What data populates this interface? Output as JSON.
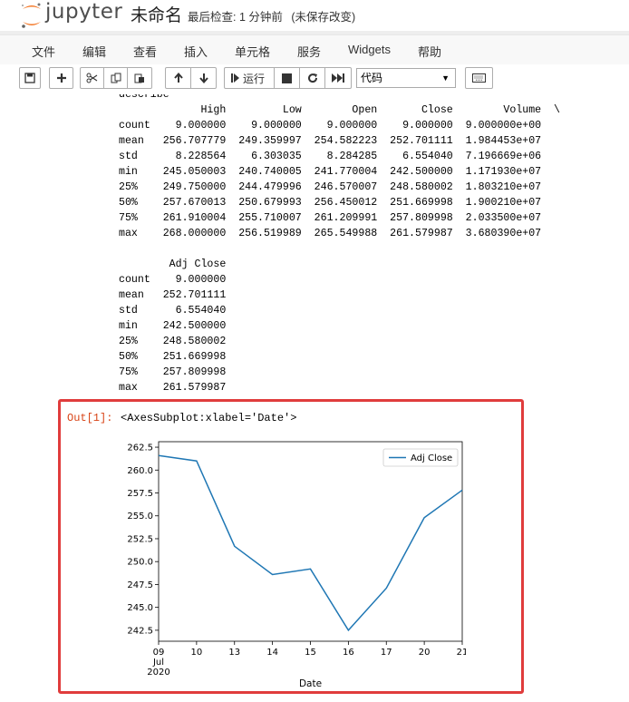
{
  "header": {
    "logo_text": "jupyter",
    "notebook_name": "未命名",
    "checkpoint_label": "最后检查: 1 分钟前",
    "unsaved": "(未保存改变)"
  },
  "menu": [
    "文件",
    "编辑",
    "查看",
    "插入",
    "单元格",
    "服务",
    "Widgets",
    "帮助"
  ],
  "toolbar": {
    "run_label": "运行",
    "cell_type": "代码",
    "icons": [
      "save-icon",
      "plus-icon",
      "cut-icon",
      "copy-icon",
      "paste-icon",
      "arrow-up-icon",
      "arrow-down-icon",
      "step-forward-icon",
      "stop-icon",
      "restart-icon",
      "fast-forward-icon",
      "keyboard-icon"
    ]
  },
  "output": {
    "describe_lines": [
      "describe",
      "             High         Low        Open       Close        Volume  \\",
      "count    9.000000    9.000000    9.000000    9.000000  9.000000e+00",
      "mean   256.707779  249.359997  254.582223  252.701111  1.984453e+07",
      "std      8.228564    6.303035    8.284285    6.554040  7.196669e+06",
      "min    245.050003  240.740005  241.770004  242.500000  1.171930e+07",
      "25%    249.750000  244.479996  246.570007  248.580002  1.803210e+07",
      "50%    257.670013  250.679993  256.450012  251.669998  1.900210e+07",
      "75%    261.910004  255.710007  261.209991  257.809998  2.033500e+07",
      "max    268.000000  256.519989  265.549988  261.579987  3.680390e+07",
      "",
      "        Adj Close",
      "count    9.000000",
      "mean   252.701111",
      "std      6.554040",
      "min    242.500000",
      "25%    248.580002",
      "50%    251.669998",
      "75%    257.809998",
      "max    261.579987"
    ],
    "out_prompt": "Out[1]:",
    "out_text": "<AxesSubplot:xlabel='Date'>"
  },
  "chart_data": {
    "type": "line",
    "x": [
      "09",
      "10",
      "13",
      "14",
      "15",
      "16",
      "17",
      "20",
      "21"
    ],
    "x_sub_labels": [
      "Jul",
      "2020"
    ],
    "series": [
      {
        "name": "Adj Close",
        "color": "#1f77b4",
        "values": [
          261.58,
          261.0,
          251.67,
          248.58,
          249.2,
          242.5,
          247.1,
          254.8,
          257.81
        ]
      }
    ],
    "xlabel": "Date",
    "ylabel": "",
    "ylim": [
      241.3,
      263.1
    ],
    "yticks": [
      242.5,
      245.0,
      247.5,
      250.0,
      252.5,
      255.0,
      257.5,
      260.0,
      262.5
    ],
    "ytick_labels": [
      "242.5",
      "245.0",
      "247.5",
      "250.0",
      "252.5",
      "255.0",
      "257.5",
      "260.0",
      "262.5"
    ],
    "legend_position": "top-right",
    "grid": false
  }
}
